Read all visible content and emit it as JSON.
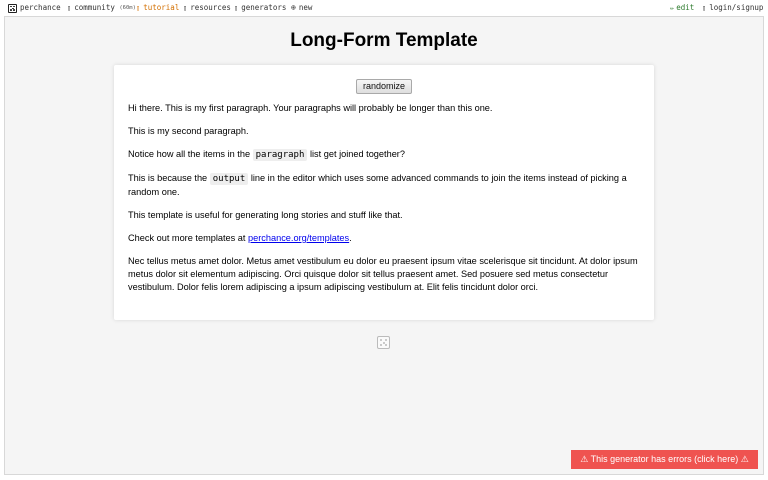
{
  "nav": {
    "brand": "perchance",
    "community": "community",
    "community_count": "(60m)",
    "tutorial": "tutorial",
    "resources": "resources",
    "generators": "generators",
    "new": "new",
    "edit": "edit",
    "login": "login/signup"
  },
  "page": {
    "title": "Long-Form Template",
    "randomize_label": "randomize"
  },
  "content": {
    "p1": "Hi there. This is my first paragraph. Your paragraphs will probably be longer than this one.",
    "p2": "This is my second paragraph.",
    "p3_before": "Notice how all the items in the",
    "p3_code": "paragraph",
    "p3_after": "list get joined together?",
    "p4_before": "This is because the",
    "p4_code": "output",
    "p4_after": "line in the editor which uses some advanced commands to join the items instead of picking a random one.",
    "p5": "This template is useful for generating long stories and stuff like that.",
    "p6_before": "Check out more templates at",
    "p6_link": "perchance.org/templates",
    "p6_after": ".",
    "p7": "Nec tellus metus amet dolor. Metus amet vestibulum eu dolor eu praesent ipsum vitae scelerisque sit tincidunt. At dolor ipsum metus dolor sit elementum adipiscing. Orci quisque dolor sit tellus praesent amet. Sed posuere sed metus consectetur vestibulum. Dolor felis lorem adipiscing a ipsum adipiscing vestibulum at. Elit felis tincidunt dolor orci."
  },
  "error_banner": "⚠ This generator has errors (click here) ⚠",
  "colors": {
    "tutorial": "#d36f00",
    "edit": "#2c7a2c",
    "error": "#ef5350",
    "link": "#0000ee"
  }
}
